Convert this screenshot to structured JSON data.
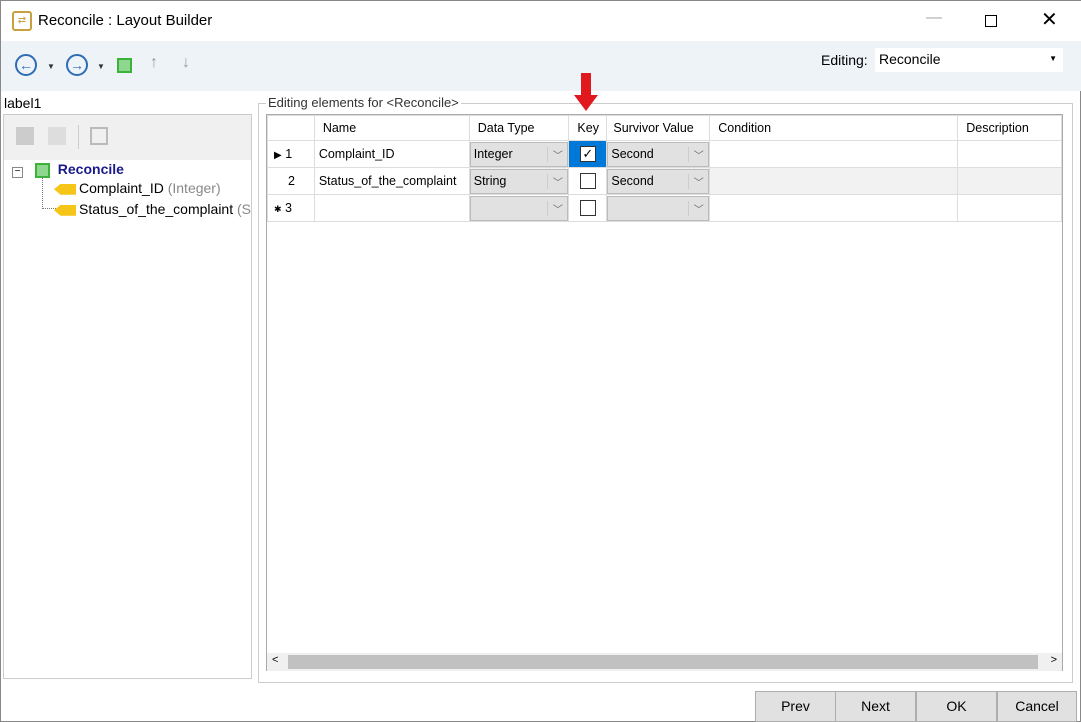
{
  "window": {
    "title": "Reconcile : Layout Builder"
  },
  "toolbar": {
    "editing_label": "Editing:",
    "editing_value": "Reconcile"
  },
  "left": {
    "label": "label1",
    "root": "Reconcile",
    "items": [
      {
        "name": "Complaint_ID",
        "type": "(Integer)"
      },
      {
        "name": "Status_of_the_complaint",
        "type": "(S"
      }
    ]
  },
  "grid": {
    "group_title": "Editing elements for <Reconcile>",
    "columns": [
      "Name",
      "Data Type",
      "Key",
      "Survivor Value",
      "Condition",
      "Description"
    ],
    "rows": [
      {
        "num": "1",
        "name": "Complaint_ID",
        "type": "Integer",
        "key": true,
        "survivor": "Second",
        "condition": "",
        "description": ""
      },
      {
        "num": "2",
        "name": "Status_of_the_complaint",
        "type": "String",
        "key": false,
        "survivor": "Second",
        "condition": "",
        "description": ""
      },
      {
        "num": "3",
        "name": "",
        "type": "",
        "key": false,
        "survivor": "",
        "condition": "",
        "description": ""
      }
    ]
  },
  "buttons": {
    "prev": "Prev",
    "next": "Next",
    "ok": "OK",
    "cancel": "Cancel"
  },
  "colors": {
    "accent": "#0078d7",
    "arrow": "#e0191e",
    "toolbar_bg": "#eef3f8"
  }
}
